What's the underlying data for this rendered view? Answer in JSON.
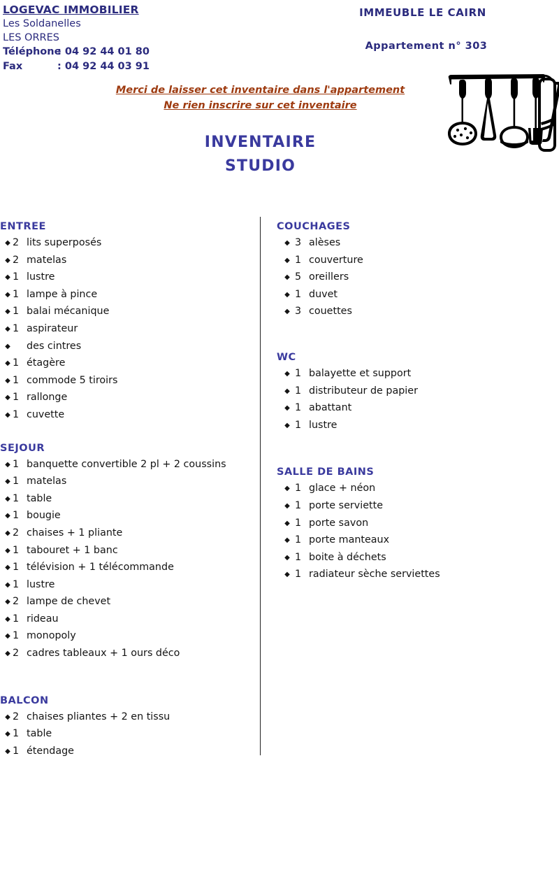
{
  "header": {
    "agency_name": "LOGEVAC IMMOBILIER",
    "address_line1": "Les Soldanelles",
    "address_line2": "LES ORRES",
    "phone_label": "Téléphone",
    "phone_sep": ":",
    "phone_value": "04 92 44 01 80",
    "fax_label": "Fax",
    "fax_sep": ":",
    "fax_value": "04 92 44 03 91",
    "building_name": "IMMEUBLE LE CAIRN",
    "apartment_number": "Appartement n° 303"
  },
  "notice": {
    "line1": "Merci de laisser cet inventaire dans l'appartement",
    "line2": "Ne rien inscrire sur cet inventaire"
  },
  "title": {
    "line1": "INVENTAIRE",
    "line2": "STUDIO"
  },
  "clipart": {
    "name": "kitchen-utensils-rail-illustration"
  },
  "bullet_glyph": "◆",
  "colors": {
    "navy": "#2b2b7e",
    "heading_blue": "#3a3a9e",
    "notice_brown": "#9e3b10",
    "body_black": "#141414",
    "divider": "#222222"
  },
  "left_column": [
    {
      "title": "ENTREE",
      "items": [
        {
          "qty": "2",
          "label": "lits superposés"
        },
        {
          "qty": "2",
          "label": "matelas"
        },
        {
          "qty": "1",
          "label": "lustre"
        },
        {
          "qty": "1",
          "label": "lampe à pince"
        },
        {
          "qty": "1",
          "label": "balai mécanique"
        },
        {
          "qty": "1",
          "label": "aspirateur"
        },
        {
          "qty": "",
          "label": "des cintres"
        },
        {
          "qty": "1",
          "label": "étagère"
        },
        {
          "qty": "1",
          "label": "commode 5 tiroirs"
        },
        {
          "qty": "1",
          "label": "rallonge"
        },
        {
          "qty": "1",
          "label": "cuvette"
        }
      ]
    },
    {
      "title": "SEJOUR",
      "items": [
        {
          "qty": "1",
          "label": "banquette convertible 2 pl + 2 coussins"
        },
        {
          "qty": "1",
          "label": "matelas"
        },
        {
          "qty": "1",
          "label": "table"
        },
        {
          "qty": "1",
          "label": "bougie"
        },
        {
          "qty": "2",
          "label": "chaises + 1 pliante"
        },
        {
          "qty": "1",
          "label": "tabouret + 1 banc"
        },
        {
          "qty": "1",
          "label": "télévision + 1 télécommande"
        },
        {
          "qty": "1",
          "label": "lustre"
        },
        {
          "qty": "2",
          "label": "lampe de chevet"
        },
        {
          "qty": "1",
          "label": "rideau"
        },
        {
          "qty": "1",
          "label": "monopoly"
        },
        {
          "qty": "2",
          "label": "cadres tableaux + 1 ours déco"
        }
      ]
    },
    {
      "title": "BALCON",
      "items": [
        {
          "qty": "2",
          "label": "chaises pliantes + 2 en tissu"
        },
        {
          "qty": "1",
          "label": "table"
        },
        {
          "qty": "1",
          "label": "étendage"
        }
      ]
    }
  ],
  "right_column": [
    {
      "title": "COUCHAGES",
      "items": [
        {
          "qty": "3",
          "label": "alèses"
        },
        {
          "qty": "1",
          "label": "couverture"
        },
        {
          "qty": "5",
          "label": "oreillers"
        },
        {
          "qty": "1",
          "label": "duvet"
        },
        {
          "qty": "3",
          "label": "couettes"
        }
      ]
    },
    {
      "title": "WC",
      "items": [
        {
          "qty": "1",
          "label": "balayette et support"
        },
        {
          "qty": "1",
          "label": "distributeur de papier"
        },
        {
          "qty": "1",
          "label": "abattant"
        },
        {
          "qty": "1",
          "label": "lustre"
        }
      ]
    },
    {
      "title": "SALLE DE BAINS",
      "items": [
        {
          "qty": "1",
          "label": "glace + néon"
        },
        {
          "qty": "1",
          "label": "porte serviette"
        },
        {
          "qty": "1",
          "label": "porte savon"
        },
        {
          "qty": "1",
          "label": "porte manteaux"
        },
        {
          "qty": "1",
          "label": "boite à déchets"
        },
        {
          "qty": "1",
          "label": "radiateur sèche serviettes"
        }
      ]
    }
  ]
}
